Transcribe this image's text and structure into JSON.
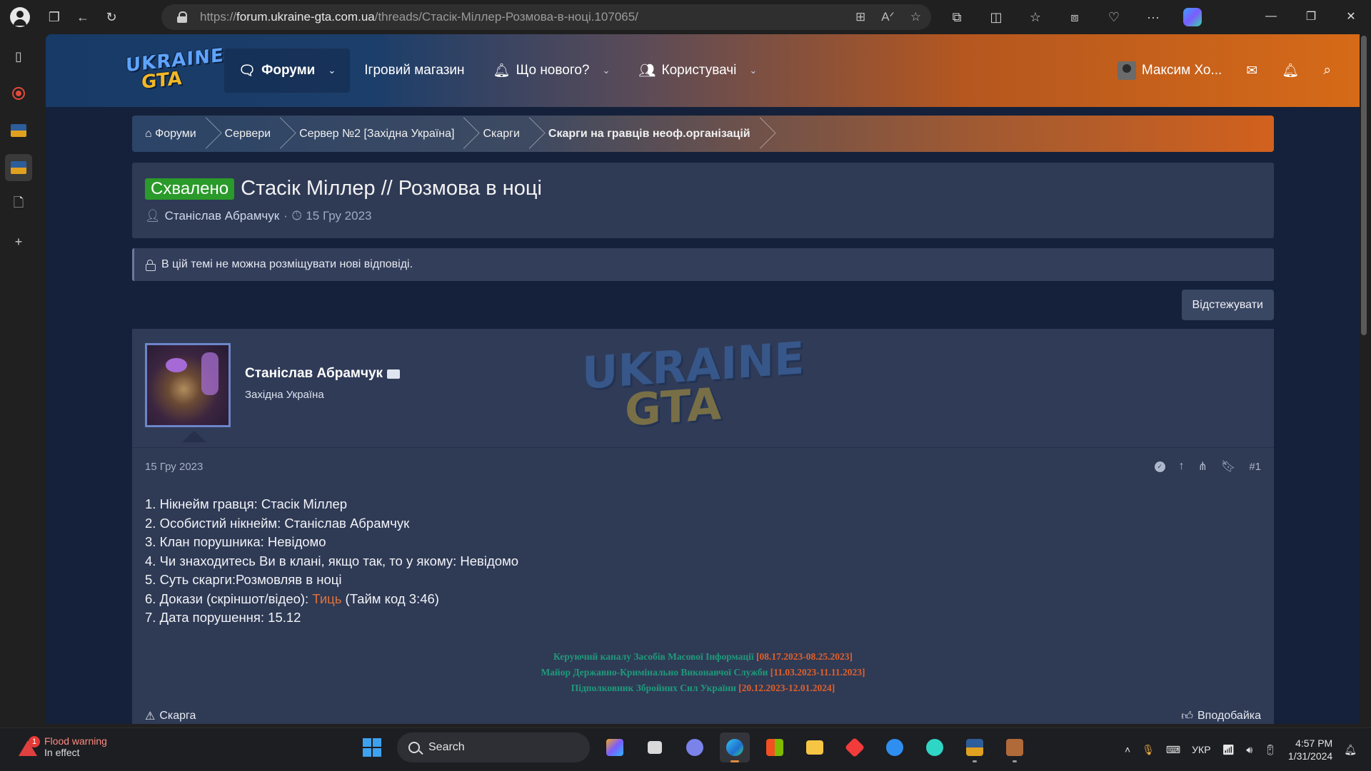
{
  "browser": {
    "url_scheme": "https://",
    "url_host": "forum.ukraine-gta.com.ua",
    "url_path": "/threads/Стасік-Міллер-Розмова-в-ноці.107065/"
  },
  "site": {
    "logo_top": "UKRAINE",
    "logo_bottom": "GTA",
    "nav": {
      "forums": "Форуми",
      "shop": "Ігровий магазин",
      "whats_new": "Що нового?",
      "members": "Користувачі"
    },
    "user_name": "Максим Хо..."
  },
  "breadcrumb": [
    "Форуми",
    "Сервери",
    "Сервер №2 [Західна Україна]",
    "Скарги",
    "Скарги на гравців неоф.організацій"
  ],
  "thread": {
    "prefix": "Схвалено",
    "title": "Стасік Міллер // Розмова в ноці",
    "author": "Станіслав Абрамчук",
    "date": "15 Гру 2023",
    "locked_notice": "В цій темі не можна розміщувати нові відповіді.",
    "watch_label": "Відстежувати"
  },
  "post": {
    "author": "Станіслав Абрамчук",
    "user_title": "Західна Україна",
    "date": "15 Гру 2023",
    "number": "#1",
    "lines": [
      "1. Нікнейм гравця: Стасік Міллер",
      "2. Особистий нікнейм: Станіслав Абрамчук",
      "3. Клан порушника: Невідомо",
      "4. Чи знаходитесь Ви в клані, якщо так, то у якому: Невідомо",
      "5. Суть скарги:Розмовляв в ноці"
    ],
    "evidence_prefix": "6. Докази (скріншот/відео): ",
    "evidence_link": "Тиць",
    "evidence_suffix": " (Тайм код 3:46)",
    "violation_date": "7. Дата порушення: 15.12",
    "signature": [
      {
        "role": "Керуючий каналу Засобів Масової Інформації ",
        "period": "[08.17.2023-08.25.2023]"
      },
      {
        "role": "Майор Державно-Кримінально Виконавчої Служби ",
        "period": "[11.03.2023-11.11.2023]"
      },
      {
        "role": "Підполковник Збройних Сил України ",
        "period": "[20.12.2023-12.01.2024]"
      }
    ],
    "report_label": "Скарга",
    "like_label": "Вподобайка"
  },
  "taskbar": {
    "weather_title": "Flood warning",
    "weather_sub": "In effect",
    "weather_badge": "1",
    "search_placeholder": "Search",
    "language": "УКР",
    "time": "4:57 PM",
    "date": "1/31/2024"
  }
}
